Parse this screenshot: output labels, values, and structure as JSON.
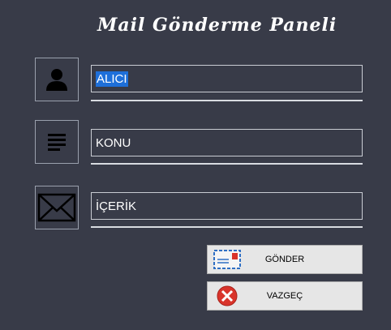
{
  "panel": {
    "title": "Mail Gönderme Paneli"
  },
  "fields": {
    "recipient": {
      "value": "ALICI",
      "icon": "user-icon"
    },
    "subject": {
      "value": "KONU",
      "icon": "lines-icon"
    },
    "body": {
      "value": "İÇERİK",
      "icon": "envelope-icon"
    }
  },
  "buttons": {
    "send": {
      "label": "GÖNDER",
      "icon": "mail-stamp-icon"
    },
    "cancel": {
      "label": "VAZGEÇ",
      "icon": "cancel-x-icon"
    }
  },
  "colors": {
    "background": "#383b48",
    "selection": "#1e6fd9",
    "cancel_red": "#d9342b"
  }
}
